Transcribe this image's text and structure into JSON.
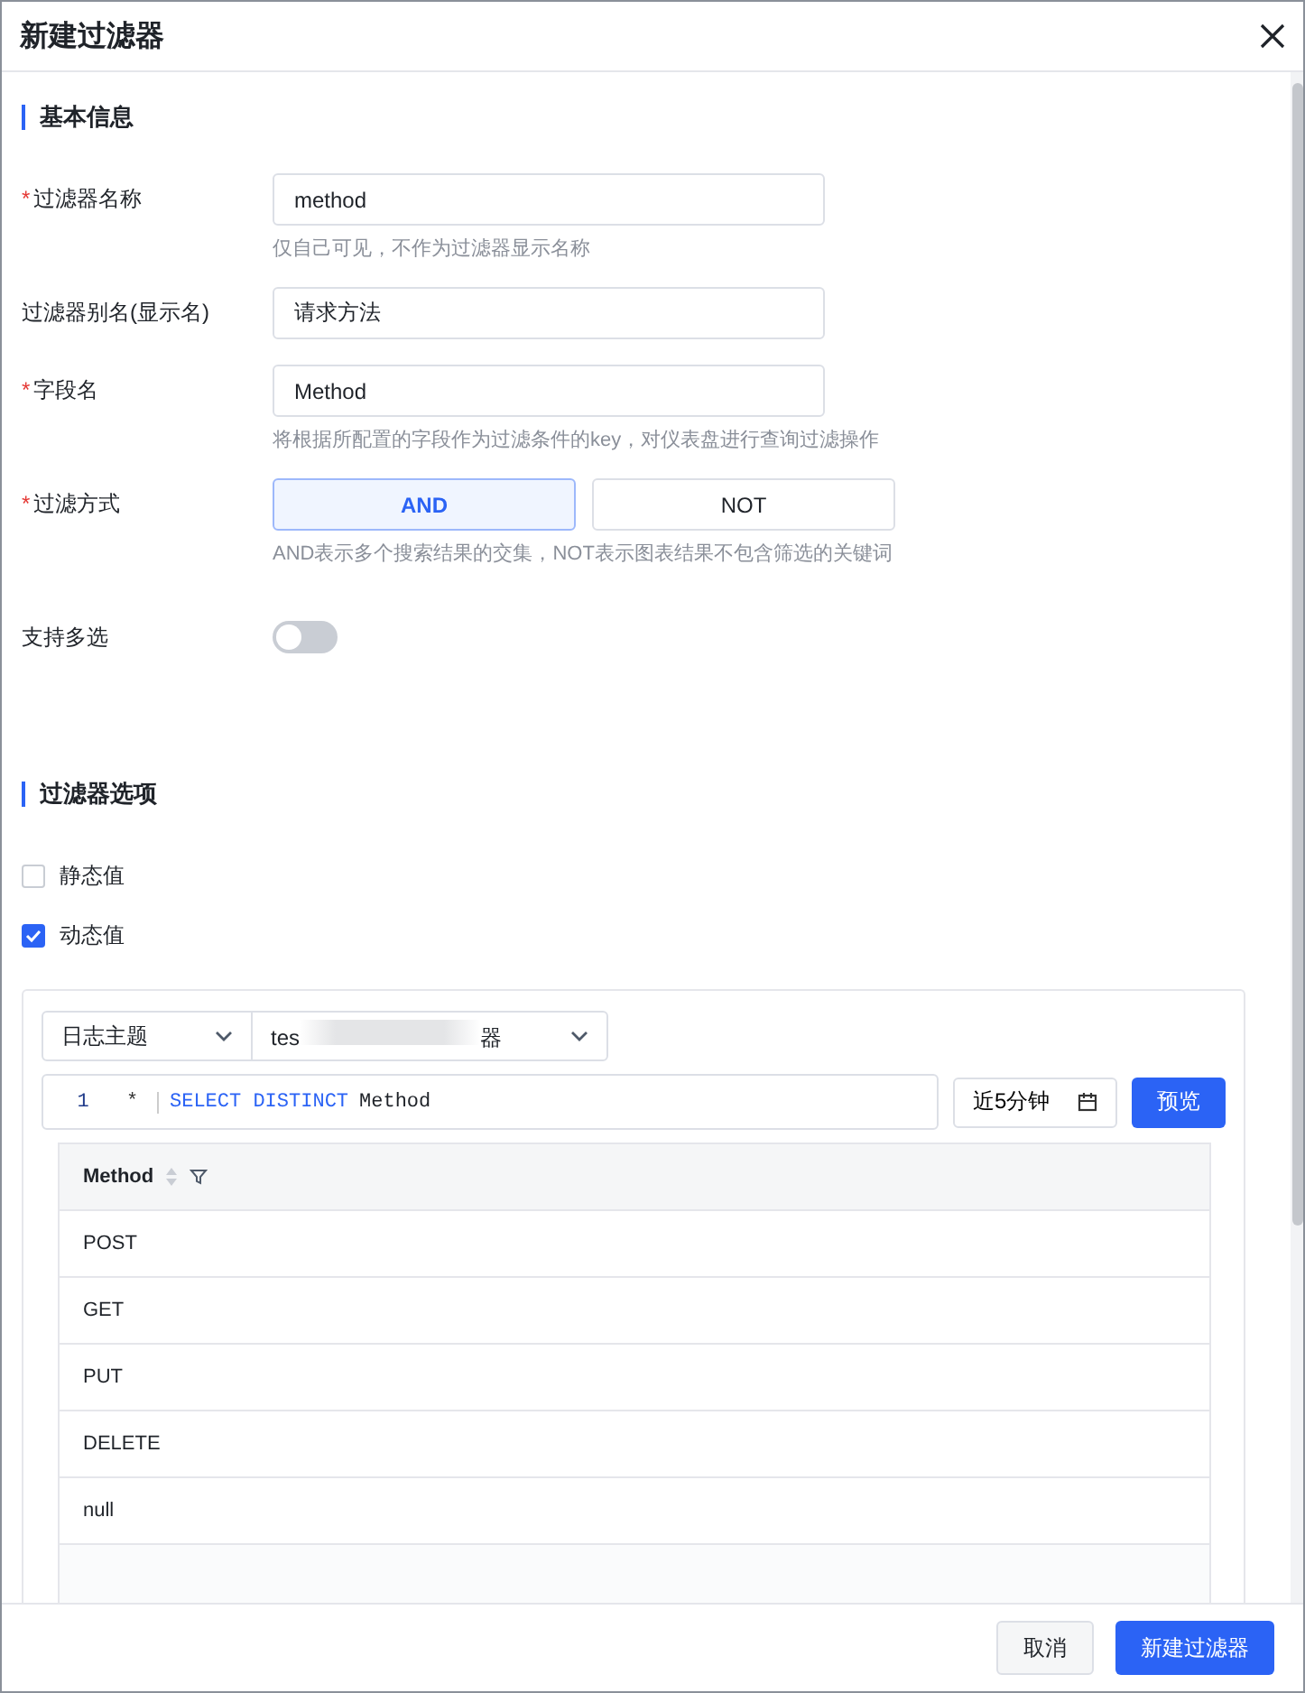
{
  "dialog": {
    "title": "新建过滤器"
  },
  "sections": [
    {
      "title": "基本信息"
    },
    {
      "title": "过滤器选项"
    }
  ],
  "form": [
    {
      "kind": "input",
      "label": "过滤器名称",
      "required": true,
      "value": "method",
      "hint": "仅自己可见，不作为过滤器显示名称"
    },
    {
      "kind": "input",
      "label": "过滤器别名(显示名)",
      "required": false,
      "value": "请求方法"
    },
    {
      "kind": "input",
      "label": "字段名",
      "required": true,
      "value": "Method",
      "hint": "将根据所配置的字段作为过滤条件的key，对仪表盘进行查询过滤操作"
    },
    {
      "kind": "segmented",
      "label": "过滤方式",
      "required": true,
      "options": [
        {
          "label": "AND",
          "selected": true
        },
        {
          "label": "NOT",
          "selected": false
        }
      ],
      "hint": "AND表示多个搜索结果的交集，NOT表示图表结果不包含筛选的关键词"
    },
    {
      "kind": "switch",
      "label": "支持多选",
      "required": false,
      "on": false
    }
  ],
  "options": [
    {
      "label": "静态值",
      "checked": false
    },
    {
      "label": "动态值",
      "checked": true
    }
  ],
  "query": {
    "source_type": "日志主题",
    "source_start": "tes",
    "source_end": "器",
    "line_number": "1",
    "prompt": "*",
    "keywords": "SELECT DISTINCT",
    "field": "Method",
    "time_range": "近5分钟",
    "preview": "预览"
  },
  "table": {
    "column": "Method",
    "rows": [
      "POST",
      "GET",
      "PUT",
      "DELETE",
      "null"
    ]
  },
  "footer": {
    "cancel": "取消",
    "confirm": "新建过滤器"
  }
}
